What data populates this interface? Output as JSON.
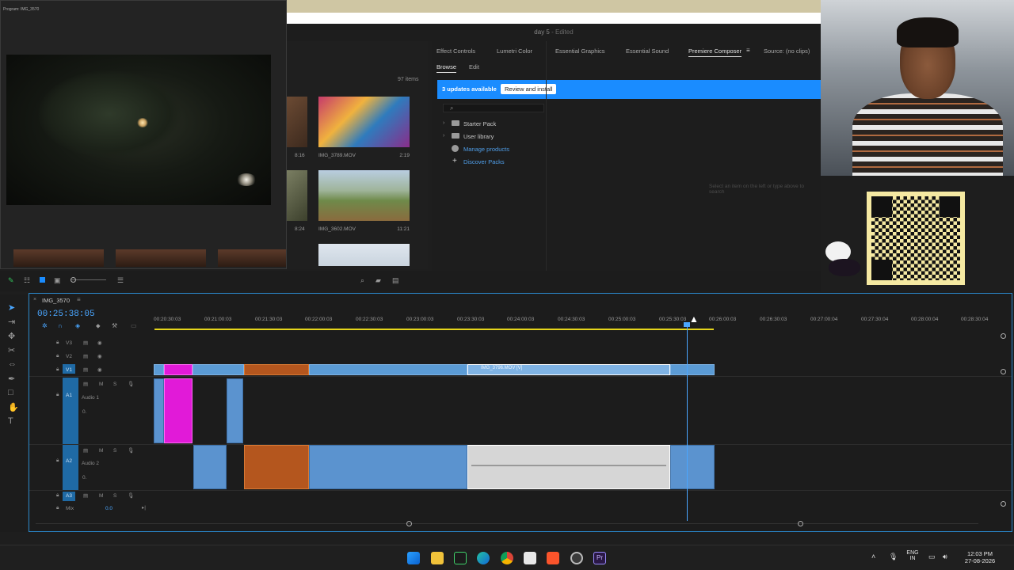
{
  "app": {
    "title": "day 5",
    "edited": "- Edited"
  },
  "monitor": {
    "title": "Program: IMG_3570"
  },
  "project": {
    "item_count": "97 items",
    "clips": [
      {
        "name": "IMG_3789.MOV",
        "duration": "2:19",
        "left_duration": "8:16"
      },
      {
        "name": "IMG_3602.MOV",
        "duration": "11:21",
        "left_duration": "8:24"
      }
    ]
  },
  "panel": {
    "tabs": [
      "Effect Controls",
      "Lumetri Color",
      "Essential Graphics",
      "Essential Sound",
      "Premiere Composer",
      "Source: (no clips)"
    ],
    "subtabs": [
      "Browse",
      "Edit"
    ],
    "update": {
      "text": "3 updates available",
      "button": "Review and install"
    },
    "tree": [
      {
        "label": "Starter Pack"
      },
      {
        "label": "User library"
      },
      {
        "label": "Manage products"
      },
      {
        "label": "Discover Packs"
      }
    ],
    "hint": "Select an item on the left or type above to search"
  },
  "timeline": {
    "sequence": "IMG_3570",
    "timecode": "00:25:38:05",
    "ruler": [
      "00:20:30:03",
      "00:21:00:03",
      "00:21:30:03",
      "00:22:00:03",
      "00:22:30:03",
      "00:23:00:03",
      "00:23:30:03",
      "00:24:00:03",
      "00:24:30:03",
      "00:25:00:03",
      "00:25:30:03",
      "00:26:00:03",
      "00:26:30:03",
      "00:27:00:04",
      "00:27:30:04",
      "00:28:00:04",
      "00:28:30:04"
    ],
    "tracks": {
      "v3": "V3",
      "v2": "V2",
      "v1": "V1",
      "a1": "A1",
      "a1_name": "Audio 1",
      "a2": "A2",
      "a2_name": "Audio 2",
      "a3": "A3",
      "mix": "Mix",
      "mix_value": "0.0",
      "a1_vol": "0.",
      "a2_vol": "0."
    },
    "clip_label": "IMG_3796.MOV [V]"
  },
  "taskbar": {
    "lang": "ENG",
    "region": "IN",
    "time": "12:03 PM",
    "date": "27-08-2026"
  },
  "colors": {
    "accent": "#1a8cff",
    "timecode": "#4aa6ff",
    "pink_clip": "#e11ad8",
    "orange_clip": "#b4561e",
    "video_clip": "#5b9bd5"
  }
}
